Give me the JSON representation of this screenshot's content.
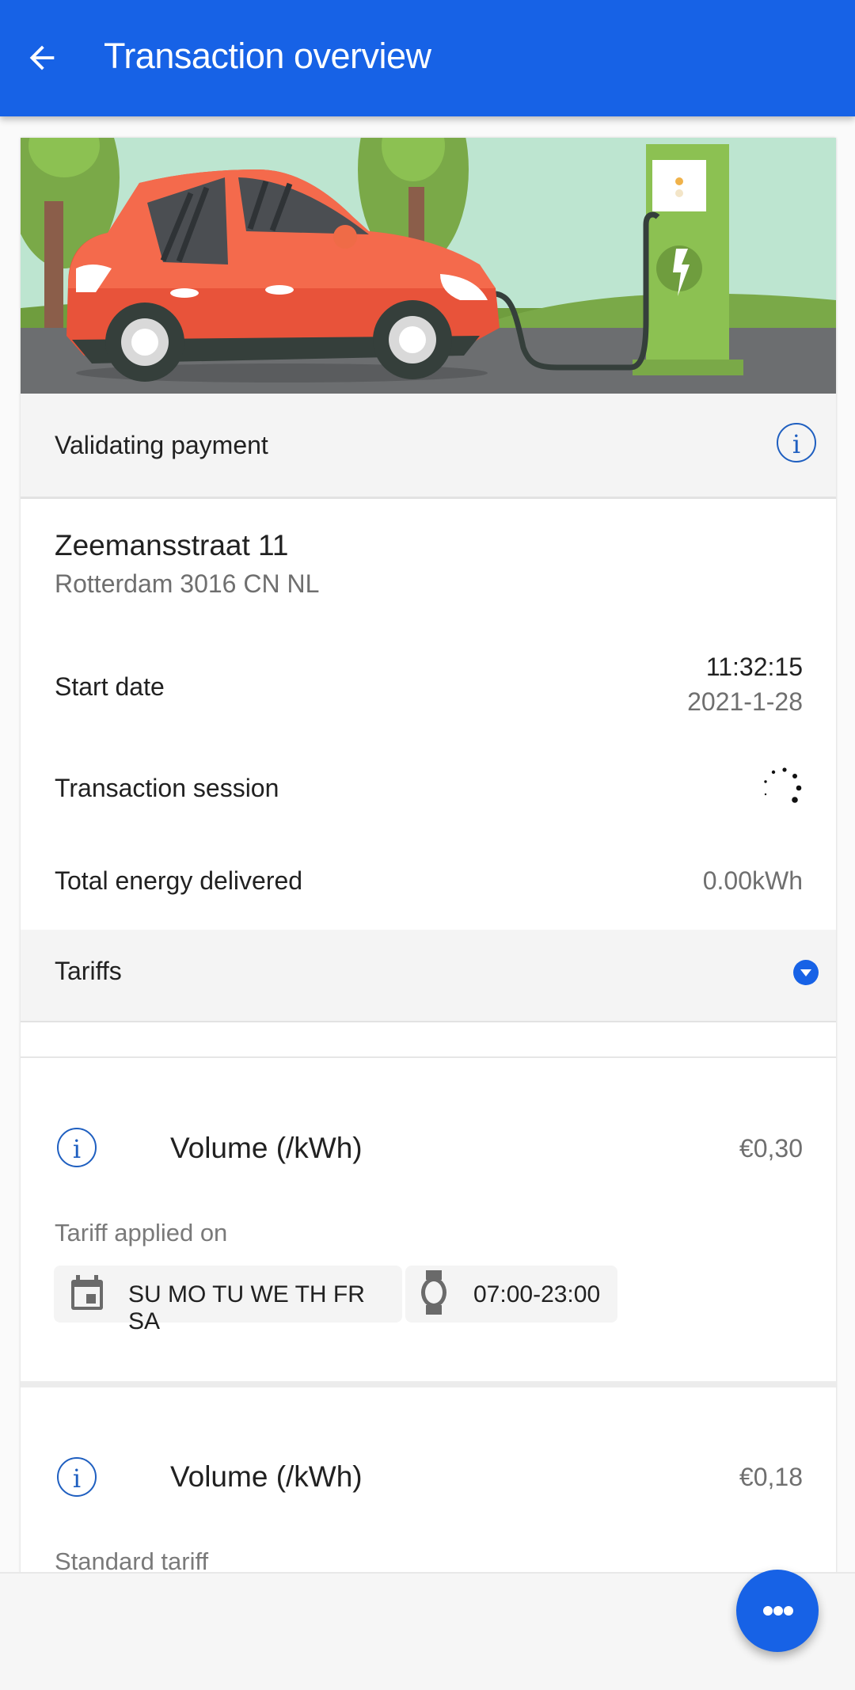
{
  "appbar": {
    "title": "Transaction overview",
    "back_icon": "arrow-left-icon",
    "color": "#1762e6"
  },
  "hero": {
    "illustration": "electric-car-charging-illustration"
  },
  "status": {
    "label": "Validating payment",
    "icon": "info-icon"
  },
  "location": {
    "street": "Zeemansstraat 11",
    "city_line": "Rotterdam 3016 CN NL"
  },
  "details": {
    "start_date_label": "Start date",
    "start_time": "11:32:15",
    "start_date": "2021-1-28",
    "session_label": "Transaction session",
    "session_state": "loading",
    "energy_label": "Total energy delivered",
    "energy_value": "0.00kWh"
  },
  "tariffs": {
    "label": "Tariffs",
    "expand_icon": "chevron-down-circle-icon",
    "items": [
      {
        "name": "Volume (/kWh)",
        "price": "€0,30",
        "note": "Tariff applied on",
        "days": "SU MO TU WE TH FR SA",
        "hours": "07:00-23:00",
        "info_icon": "i"
      },
      {
        "name": "Volume (/kWh)",
        "price": "€0,18",
        "note": "Standard tariff",
        "info_icon": "i"
      }
    ]
  },
  "fab": {
    "icon": "more-horizontal-icon"
  }
}
